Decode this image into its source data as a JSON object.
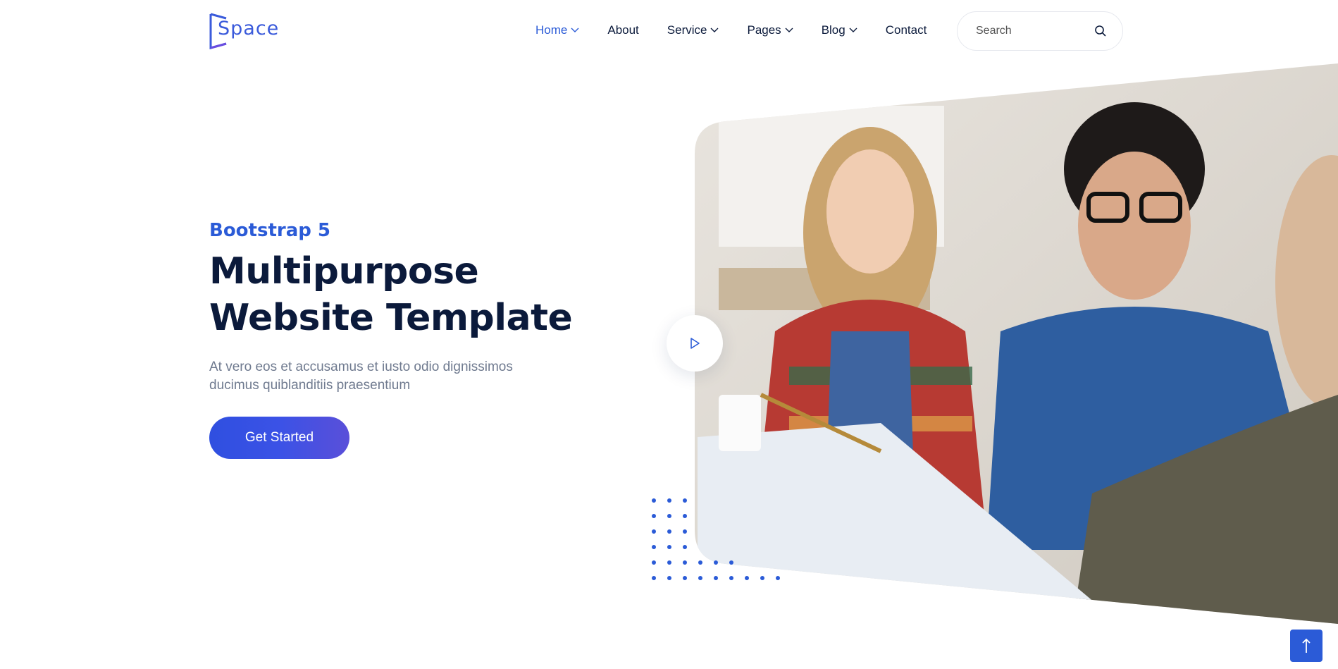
{
  "brand": {
    "name": "Space",
    "logo_color": "#3b5bdb"
  },
  "nav": {
    "items": [
      {
        "label": "Home",
        "active": true,
        "dropdown": true
      },
      {
        "label": "About",
        "active": false,
        "dropdown": false
      },
      {
        "label": "Service",
        "active": false,
        "dropdown": true
      },
      {
        "label": "Pages",
        "active": false,
        "dropdown": true
      },
      {
        "label": "Blog",
        "active": false,
        "dropdown": true
      },
      {
        "label": "Contact",
        "active": false,
        "dropdown": false
      }
    ],
    "active_color": "#2b5bd7"
  },
  "search": {
    "placeholder": "Search",
    "icon": "search-icon"
  },
  "hero": {
    "eyebrow": "Bootstrap 5",
    "headline_line1": "Multipurpose",
    "headline_line2": "Website Template",
    "subtext": "At vero eos et accusamus et iusto odio dignissimos ducimus quiblanditiis praesentium",
    "cta_label": "Get Started",
    "play_icon": "play-icon",
    "image_description_icon": "photo"
  },
  "scroll_top": {
    "icon": "arrow-up-icon"
  },
  "colors": {
    "accent": "#2b5bd7",
    "heading": "#0b1a3b",
    "muted": "#6f7a8f"
  }
}
